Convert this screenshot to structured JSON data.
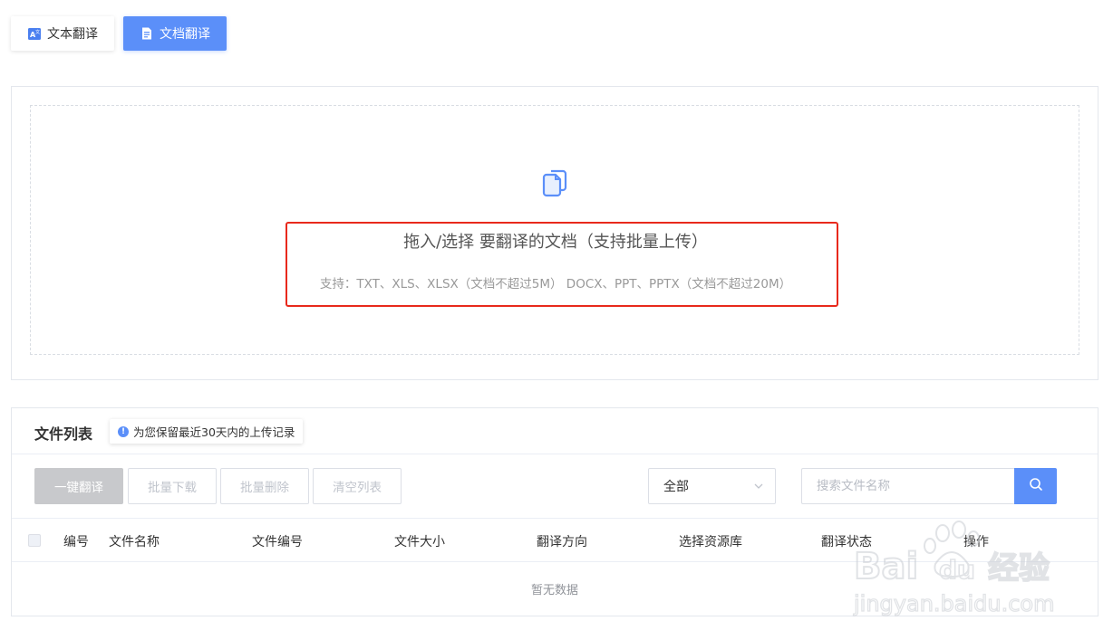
{
  "tabs": [
    {
      "label": "文本翻译",
      "icon": "text-translate-icon",
      "active": false
    },
    {
      "label": "文档翻译",
      "icon": "document-icon",
      "active": true
    }
  ],
  "upload": {
    "title": "拖入/选择 要翻译的文档（支持批量上传）",
    "support": "支持：TXT、XLS、XLSX（文档不超过5M） DOCX、PPT、PPTX（文档不超过20M）"
  },
  "file_list": {
    "title": "文件列表",
    "notice": "为您保留最近30天内的上传记录",
    "buttons": {
      "translate_all": "一键翻译",
      "batch_download": "批量下载",
      "batch_delete": "批量删除",
      "clear_list": "清空列表"
    },
    "filter": {
      "selected": "全部"
    },
    "search": {
      "placeholder": "搜索文件名称"
    },
    "columns": [
      "编号",
      "文件名称",
      "文件编号",
      "文件大小",
      "翻译方向",
      "选择资源库",
      "翻译状态",
      "操作"
    ],
    "empty_text": "暂无数据"
  },
  "colors": {
    "accent": "#5b8ff9",
    "highlight": "#e8291c"
  }
}
